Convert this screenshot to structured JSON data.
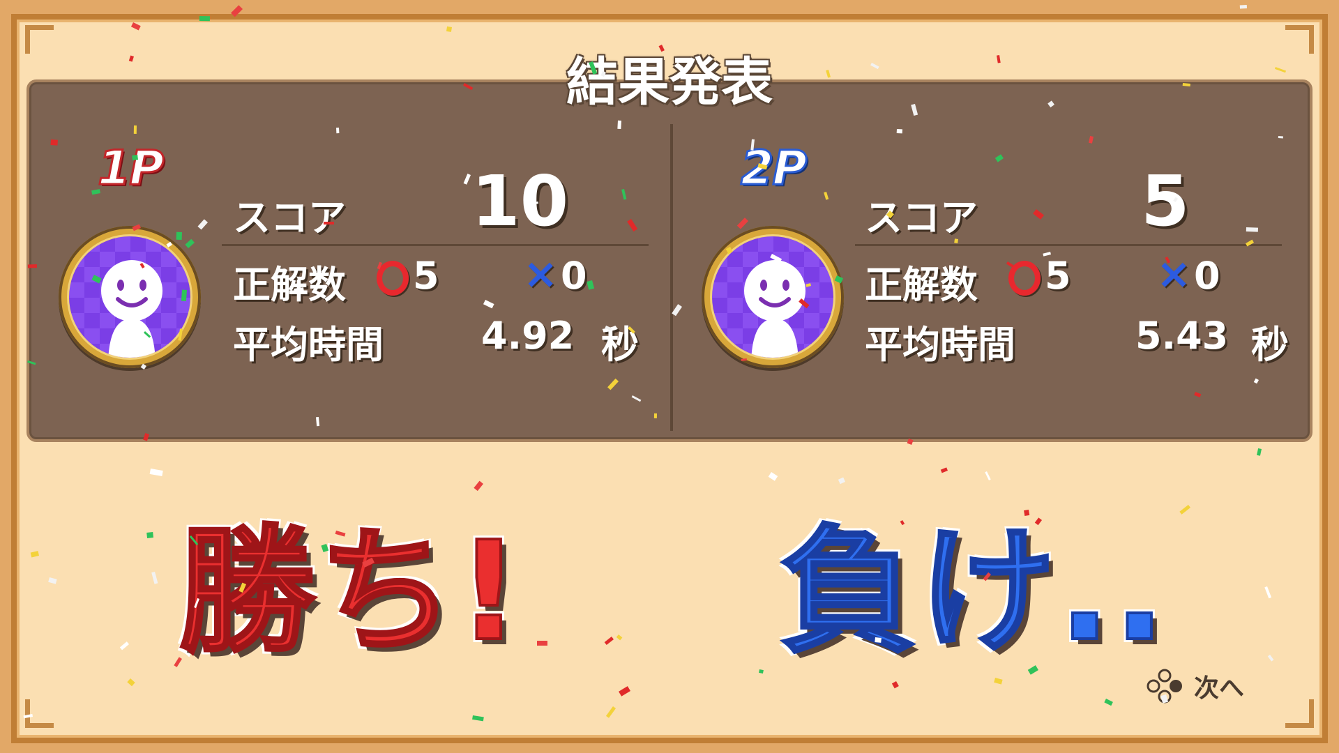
{
  "title": "結果発表",
  "players": [
    {
      "id": "1P",
      "score_label": "スコア",
      "score": "10",
      "correct_label": "正解数",
      "correct_count": "5",
      "wrong_count": "0",
      "time_label": "平均時間",
      "avg_time": "4.92",
      "time_unit": "秒",
      "label_color": "#e53034"
    },
    {
      "id": "2P",
      "score_label": "スコア",
      "score": "5",
      "correct_label": "正解数",
      "correct_count": "5",
      "wrong_count": "0",
      "time_label": "平均時間",
      "avg_time": "5.43",
      "time_unit": "秒",
      "label_color": "#2c64e0"
    }
  ],
  "results": {
    "win": "勝ち!",
    "lose": "負け.."
  },
  "next_label": "次へ",
  "icons": {
    "correct": "circle-mark",
    "wrong": "cross-mark",
    "avatar": "smiley-person-avatar",
    "next_button": "controller-buttons-icon"
  }
}
